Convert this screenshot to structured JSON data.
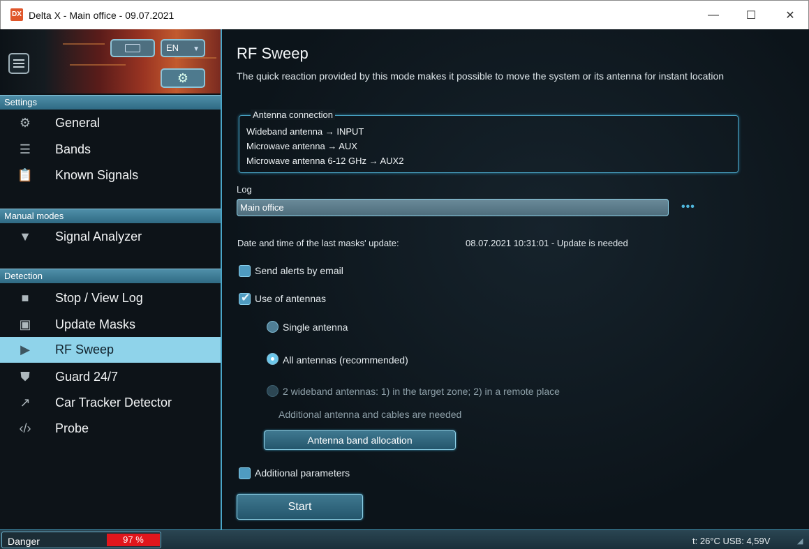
{
  "window": {
    "app_icon": "DX",
    "title": "Delta X - Main office - 09.07.2021",
    "minimize": "—",
    "maximize": "☐",
    "close": "✕"
  },
  "sidebar": {
    "lang": "EN",
    "sections": [
      {
        "title": "Settings",
        "items": [
          {
            "label": "General",
            "icon": "gear-icon"
          },
          {
            "label": "Bands",
            "icon": "list-icon"
          },
          {
            "label": "Known Signals",
            "icon": "clipboard-icon"
          }
        ]
      },
      {
        "title": "Manual modes",
        "items": [
          {
            "label": "Signal Analyzer",
            "icon": "signal-icon"
          }
        ]
      },
      {
        "title": "Detection",
        "items": [
          {
            "label": "Stop / View Log",
            "icon": "stop-icon"
          },
          {
            "label": "Update Masks",
            "icon": "image-icon"
          },
          {
            "label": "RF Sweep",
            "icon": "play-icon",
            "active": true
          },
          {
            "label": "Guard 24/7",
            "icon": "shield-icon"
          },
          {
            "label": "Car Tracker Detector",
            "icon": "trend-icon"
          },
          {
            "label": "Probe",
            "icon": "code-icon"
          }
        ]
      }
    ]
  },
  "main": {
    "title": "RF Sweep",
    "description": "The quick reaction provided by this mode makes it possible to move the system or its antenna for instant location",
    "antenna_group": {
      "legend": "Antenna connection",
      "lines": [
        "Wideband antenna → INPUT",
        "Microwave antenna → AUX",
        "Microwave antenna 6-12 GHz → AUX2"
      ]
    },
    "log": {
      "label": "Log",
      "value": "Main office",
      "more": "•••"
    },
    "masks_update": {
      "label": "Date and time of the last masks' update:",
      "value": "08.07.2021 10:31:01 - Update is needed"
    },
    "send_alerts": {
      "label": "Send alerts by email",
      "checked": false
    },
    "use_antennas": {
      "label": "Use of antennas",
      "checked": true
    },
    "antenna_options": [
      {
        "label": "Single antenna",
        "selected": false,
        "enabled": true
      },
      {
        "label": "All antennas (recommended)",
        "selected": true,
        "enabled": true
      },
      {
        "label": "2 wideband antennas: 1) in the target zone; 2) in a remote place",
        "selected": false,
        "enabled": false
      }
    ],
    "antenna_note": "Additional antenna and cables are needed",
    "band_button": "Antenna band allocation",
    "additional_params": {
      "label": "Additional parameters",
      "checked": false
    },
    "start_button": "Start"
  },
  "status": {
    "danger_label": "Danger",
    "danger_value": "97 %",
    "right_text": "t: 26°C  USB: 4,59V"
  },
  "colors": {
    "accent": "#4aa6c8",
    "active_item": "#8fd3ea",
    "danger": "#e0161c"
  }
}
